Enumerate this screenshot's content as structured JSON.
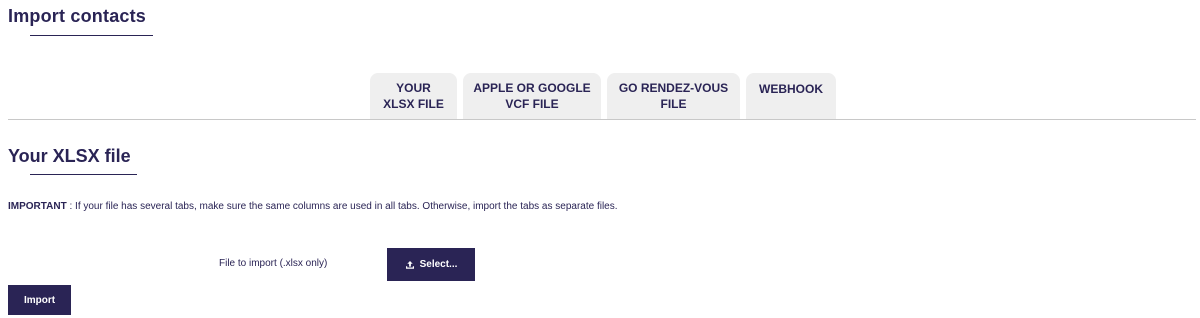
{
  "page": {
    "title": "Import contacts"
  },
  "tabs": [
    {
      "label": "YOUR\nXLSX FILE",
      "active": true
    },
    {
      "label": "APPLE OR GOOGLE\nVCF FILE",
      "active": false
    },
    {
      "label": "GO RENDEZ-VOUS\nFILE",
      "active": false
    },
    {
      "label": "WEBHOOK",
      "active": false
    }
  ],
  "section": {
    "title": "Your XLSX file",
    "notice_prefix": "IMPORTANT",
    "notice_text": " : If your file has several tabs, make sure the same columns are used in all tabs. Otherwise, import the tabs as separate files."
  },
  "file_input": {
    "label": "File to import (.xlsx only)",
    "button_label": "Select...",
    "button_icon": "upload-icon"
  },
  "actions": {
    "import_label": "Import"
  },
  "colors": {
    "primary": "#2a2455",
    "tab_background": "#efefef",
    "divider": "#c8c8c8"
  }
}
